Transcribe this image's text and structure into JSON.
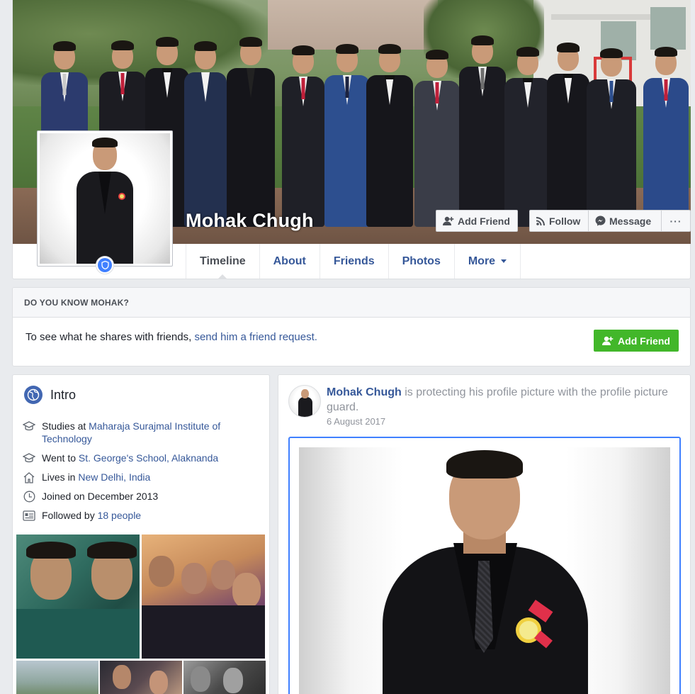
{
  "profile": {
    "name": "Mohak Chugh"
  },
  "cover_actions": {
    "add_friend": "Add Friend",
    "follow": "Follow",
    "message": "Message",
    "more": "···"
  },
  "tabs": [
    {
      "label": "Timeline",
      "active": true
    },
    {
      "label": "About"
    },
    {
      "label": "Friends"
    },
    {
      "label": "Photos"
    },
    {
      "label": "More"
    }
  ],
  "know_card": {
    "header": "DO YOU KNOW MOHAK?",
    "text": "To see what he shares with friends, ",
    "link": "send him a friend request.",
    "button": "Add Friend"
  },
  "intro": {
    "title": "Intro",
    "items": [
      {
        "icon": "graduation-cap-icon",
        "prefix": "Studies at ",
        "link": "Maharaja Surajmal Institute of Technology"
      },
      {
        "icon": "graduation-cap-icon",
        "prefix": "Went to ",
        "link": "St. George's School, Alaknanda"
      },
      {
        "icon": "home-icon",
        "prefix": "Lives in ",
        "link": "New Delhi, India"
      },
      {
        "icon": "clock-icon",
        "prefix": "Joined on December 2013",
        "link": ""
      },
      {
        "icon": "followers-icon",
        "prefix": "Followed by ",
        "link": "18 people"
      }
    ]
  },
  "post": {
    "author": "Mohak Chugh",
    "action": " is protecting his profile picture with the profile picture guard.",
    "date": "6 August 2017"
  },
  "colors": {
    "link": "#365899",
    "green": "#42b72a",
    "blue_accent": "#4080ff",
    "page_bg": "#e9ebee"
  }
}
